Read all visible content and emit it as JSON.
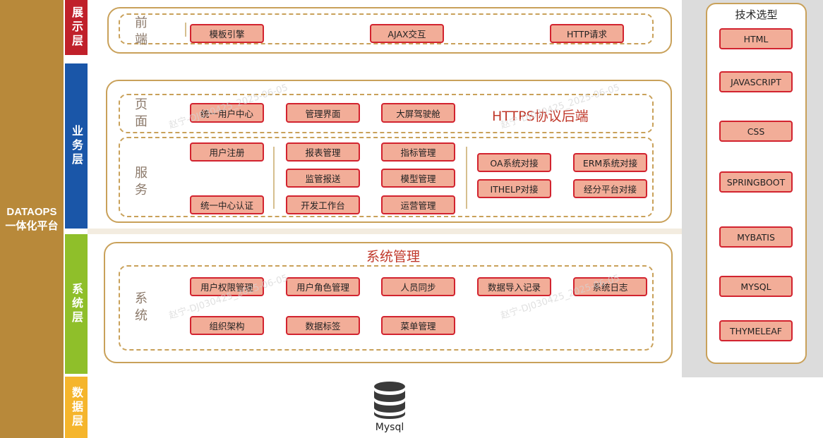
{
  "platform": {
    "line1": "DATAOPS",
    "line2": "一体化平台"
  },
  "layers": {
    "display": "展示层",
    "business": "业务层",
    "system": "系统层",
    "data": "数据层"
  },
  "colors": {
    "display": "#c0202a",
    "business": "#1a56a8",
    "system": "#8fbf2a",
    "data": "#f5b52c",
    "accent": "#d2232f",
    "box_fill": "#f2ad98",
    "border": "#c9a15a"
  },
  "frontend": {
    "label": "前端",
    "items": [
      "模板引擎",
      "AJAX交互",
      "HTTP请求"
    ]
  },
  "business": {
    "backend_title": "HTTPS协议后端",
    "pages": {
      "label": "页面",
      "items": [
        "统一用户中心",
        "管理界面",
        "大屏驾驶舱"
      ]
    },
    "services": {
      "label": "服务",
      "col1": [
        "用户注册",
        "统一中心认证"
      ],
      "col2": [
        "报表管理",
        "监管报送",
        "开发工作台"
      ],
      "col3": [
        "指标管理",
        "模型管理",
        "运营管理"
      ],
      "col4": [
        "OA系统对接",
        "ITHELP对接"
      ],
      "col5": [
        "ERM系统对接",
        "经分平台对接"
      ]
    }
  },
  "system": {
    "title": "系统管理",
    "label": "系统",
    "row1": [
      "用户权限管理",
      "用户角色管理",
      "人员同步",
      "数据导入记录",
      "系统日志"
    ],
    "row2": [
      "组织架构",
      "数据标签",
      "菜单管理"
    ]
  },
  "data": {
    "db_label": "Mysql",
    "db_icon": "database-icon"
  },
  "tech": {
    "title": "技术选型",
    "items": [
      "HTML",
      "JAVASCRIPT",
      "CSS",
      "SPRINGBOOT",
      "MYBATIS",
      "MYSQL",
      "THYMELEAF"
    ]
  },
  "watermark": "赵宁-DJ030425_2025-06-05"
}
